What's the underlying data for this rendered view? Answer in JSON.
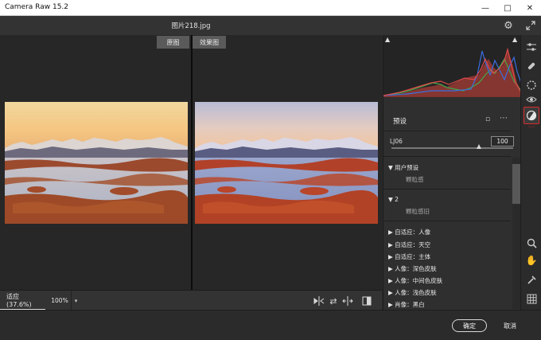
{
  "app": {
    "title": "Camera Raw 15.2"
  },
  "window": {
    "minimize_icon": "minimize-icon",
    "maximize_icon": "maximize-icon",
    "close_icon": "close-icon"
  },
  "header": {
    "filename": "图片218.jpg"
  },
  "view_tabs": {
    "before": "原图",
    "after": "效果图"
  },
  "bottom_bar": {
    "zoom_fit": "适应 (37.6%)",
    "zoom_pct": "100%"
  },
  "panel": {
    "section_title": "预设",
    "amount_label": "LJ06",
    "amount_value": "100",
    "amount_fraction": 0.72,
    "groups": [
      {
        "title": "用户预设",
        "sub": "颗粒感"
      },
      {
        "title": "2",
        "sub": "颗粒感旧"
      }
    ],
    "preset_items": [
      "自适应：人像",
      "自适应：天空",
      "自适应：主体",
      "人像：深色皮肤",
      "人像：中间色皮肤",
      "人像：浅色皮肤",
      "肖像：黑白"
    ]
  },
  "footer": {
    "ok_label": "确定",
    "cancel_label": "取消"
  },
  "colors": {
    "accent_red": "#d92b2b",
    "panel_bg": "#2f2f2f",
    "canvas_bg": "#272727"
  }
}
